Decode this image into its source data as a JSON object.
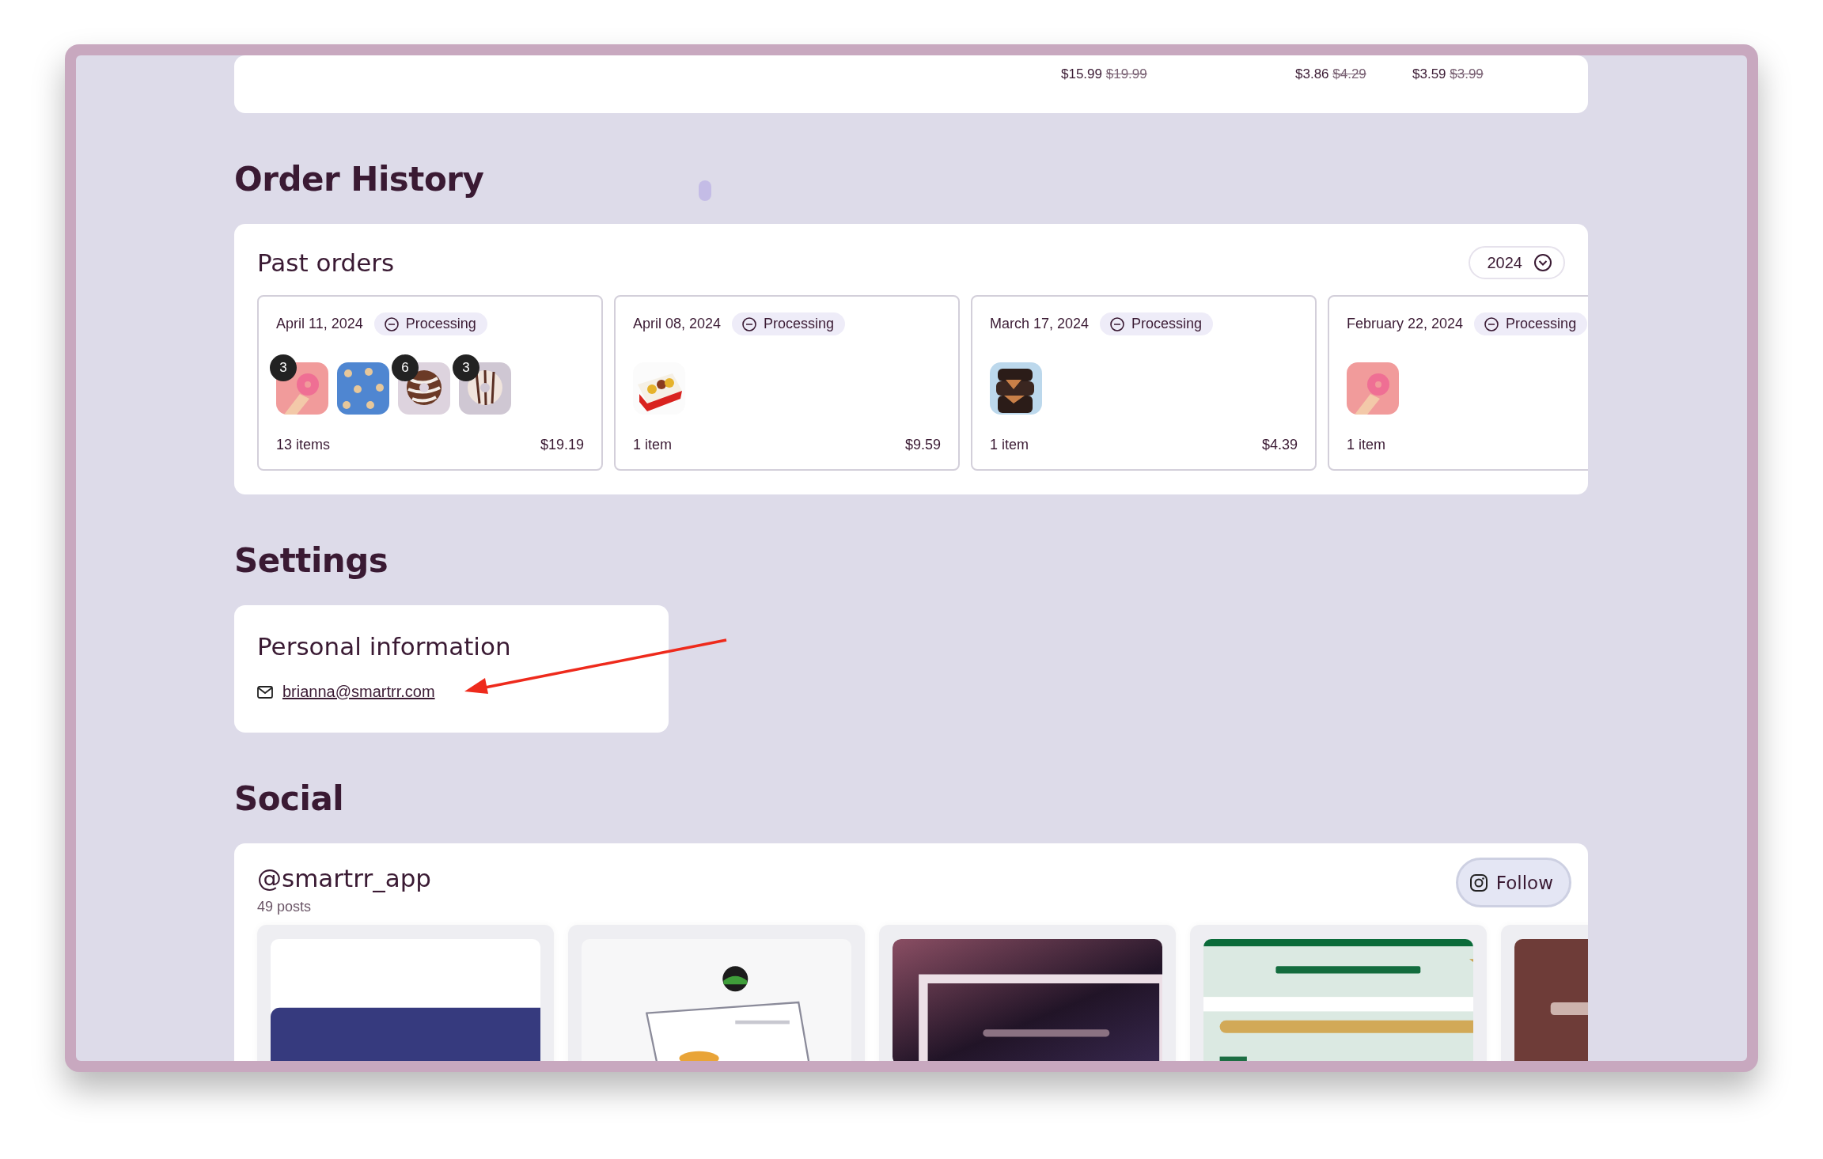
{
  "top_products": [
    {
      "price": "$15.99",
      "original_price": "$19.99"
    },
    {
      "price": "$3.86",
      "original_price": "$4.29"
    },
    {
      "price": "$3.59",
      "original_price": "$3.99"
    }
  ],
  "order_history": {
    "heading": "Order History",
    "card_title": "Past orders",
    "year": "2024",
    "orders": [
      {
        "date": "April 11, 2024",
        "status": "Processing",
        "thumbs": [
          {
            "kind": "picture",
            "badge": "3"
          },
          {
            "kind": "picture"
          },
          {
            "kind": "picture",
            "badge": "6"
          },
          {
            "kind": "picture",
            "badge": "3"
          }
        ],
        "count": "13 items",
        "total": "$19.19"
      },
      {
        "date": "April 08, 2024",
        "status": "Processing",
        "thumbs": [
          {
            "kind": "picture"
          }
        ],
        "count": "1 item",
        "total": "$9.59"
      },
      {
        "date": "March 17, 2024",
        "status": "Processing",
        "thumbs": [
          {
            "kind": "picture"
          }
        ],
        "count": "1 item",
        "total": "$4.39"
      },
      {
        "date": "February 22, 2024",
        "status": "Processing",
        "thumbs": [
          {
            "kind": "picture"
          }
        ],
        "count": "1 item"
      }
    ]
  },
  "settings": {
    "heading": "Settings",
    "card_title": "Personal information",
    "email": "brianna@smartrr.com"
  },
  "social": {
    "heading": "Social",
    "handle": "@smartrr_app",
    "posts_count": "49 posts",
    "follow": "Follow",
    "posts": [
      {
        "kind": "picture"
      },
      {
        "kind": "picture"
      },
      {
        "kind": "picture"
      },
      {
        "kind": "picture"
      },
      {
        "kind": "picture"
      }
    ]
  }
}
